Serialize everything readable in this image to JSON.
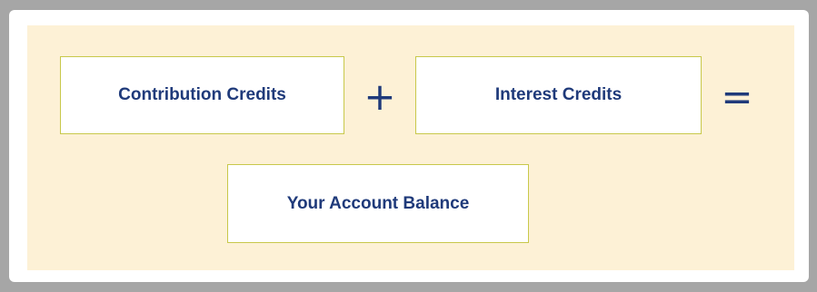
{
  "diagram": {
    "boxes": {
      "contribution": "Contribution Credits",
      "interest": "Interest Credits",
      "balance": "Your Account Balance"
    },
    "operators": {
      "plus": "+",
      "equals": "="
    }
  },
  "colors": {
    "outer_frame": "#a6a6a6",
    "panel_background": "#fdf1d6",
    "box_border": "#c8c84a",
    "text": "#1f3a7a"
  }
}
